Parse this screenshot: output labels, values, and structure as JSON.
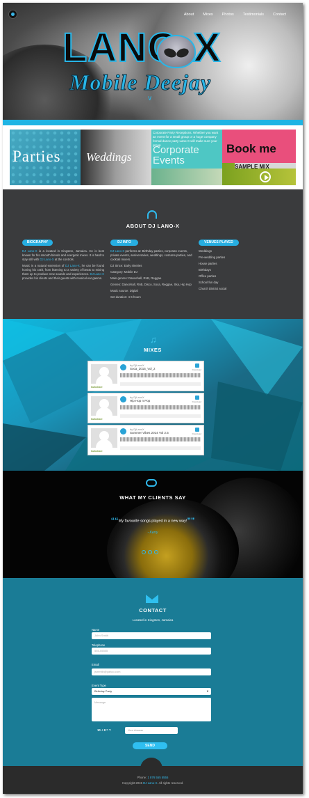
{
  "nav": {
    "items": [
      "About",
      "Mixes",
      "Photos",
      "Testimonials",
      "Contact"
    ]
  },
  "hero": {
    "brand": "LANO-X",
    "subtitle": "Mobile Deejay"
  },
  "tiles": {
    "parties": "Parties",
    "weddings": "Weddings",
    "corporate_text": "Corporate Party Receptions. Whether you want an event for a small group or a huge company formal dance party Lano-X will make sure your group",
    "corporate": "Corporate Events",
    "book": "Book me",
    "sample_mix": "SAMPLE MIX"
  },
  "about": {
    "title": "ABOUT DJ LANO-X",
    "biography": {
      "heading": "BIOGRAPHY",
      "p1_name": "DJ Lano-X",
      "p1": " is a located in Kingston, Jamaica. He is best known for his smooth blends and energetic mixes. It is hard to stay still with ",
      "p1_name2": "DJ Lano-X",
      "p1_end": " at the controls.",
      "p2_start": "Music is a natural extension of ",
      "p2_name": "DJ Lano-X",
      "p2": ", he can be found honing his craft, from listening to a variety of beats to mixing them up to produce new sounds and experiences. ",
      "p2_name2": "DJ Lano-X",
      "p2_end": " provides his clients and their guests with musical ear gasms."
    },
    "info": {
      "heading": "DJ INFO",
      "intro_name": "DJ Lano-X",
      "intro": " performs at: Birthday parties, corporate events, private events, anniversaries, weddings, costume parties, and cocktail mixers.",
      "since": "DJ Since: Early nineties",
      "category": "Category: Mobile DJ",
      "main_genres": "Main genres: Dancehall, RnB, Reggae",
      "genres": "Genres: Dancehall, RnB, Disco, Soca, Reggae, Ska, Hip Hop",
      "music_source": "Music source: Digital",
      "set_duration": "Set duration: 4-6 hours"
    },
    "venues": {
      "heading": "VENUES PLAYED",
      "items": [
        "Weddings",
        "Pre-wedding parties",
        "House parties",
        "Birthdays",
        "Office parties",
        "School fun day",
        "Church District social"
      ]
    }
  },
  "mixes": {
    "title": "MIXES",
    "players": [
      {
        "by": "by DjLanoX",
        "title": "Soca_2015_Vol_2",
        "download": "Download",
        "logo": "hulkshare"
      },
      {
        "by": "by DjLanoX",
        "title": "Hip Hop n Pop",
        "download": "Download",
        "logo": "hulkshare"
      },
      {
        "by": "by DjLanoX",
        "title": "Summer Vibes 2014 Vol 2.5",
        "download": "Download",
        "logo": "hulkshare"
      }
    ]
  },
  "clients": {
    "title": "WHAT MY CLIENTS SAY",
    "quote": "My favourite songs played in a new way!",
    "author": "- Kerry"
  },
  "contact": {
    "title": "CONTACT",
    "location": "Located in Kingston, Jamaica",
    "name_label": "Name",
    "name_placeholder": "John Smith",
    "phone_label": "Telephone",
    "phone_placeholder": "555-55555",
    "email_label": "Email",
    "email_placeholder": "jsmmith@yahoo.com",
    "event_label": "Event Type",
    "event_value": "Birthday Party",
    "message_placeholder": "Message",
    "captcha": "10 + 8 = ?",
    "captcha_placeholder": "Your Answer",
    "send": "SEND"
  },
  "footer": {
    "phone_label": "Phone: ",
    "phone": "1 876 555 5555",
    "copyright": "Copyright 2015 ",
    "copyright_name": "DJ Lano-X",
    "copyright_end": ". All rights reserved."
  }
}
